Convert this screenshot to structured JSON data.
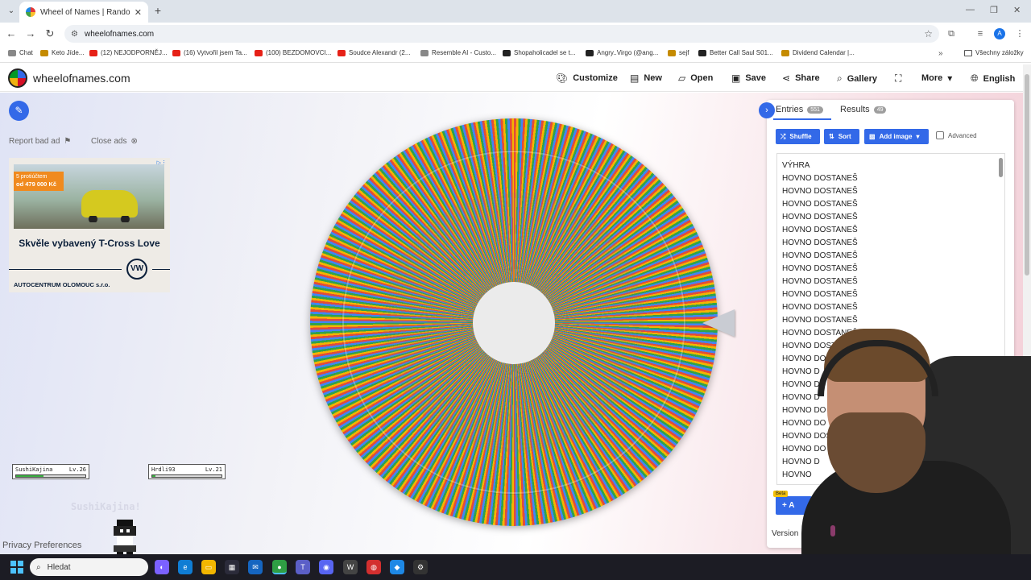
{
  "browser": {
    "tab_title": "Wheel of Names | Random nam",
    "url": "wheelofnames.com",
    "bookmarks": [
      "Chat",
      "Keto Jíde...",
      "(12) NEJODPORNĚJ...",
      "(16) Vytvořil jsem Ta...",
      "(100) BEZDOMOVCI...",
      "Soudce Alexandr (2...",
      "Resemble AI - Custo...",
      "Shopaholicadel se t...",
      "Angry..Virgo (@ang...",
      "sejf",
      "Better Call Saul S01...",
      "Dividend Calendar |..."
    ],
    "all_bookmarks": "Všechny záložky",
    "profile_initial": "A"
  },
  "site": {
    "name": "wheelofnames.com",
    "nav": {
      "customize": "Customize",
      "new": "New",
      "open": "Open",
      "save": "Save",
      "share": "Share",
      "gallery": "Gallery",
      "more": "More",
      "language": "English"
    }
  },
  "left": {
    "report_ad": "Report bad ad",
    "close_ads": "Close ads",
    "ad": {
      "promo_small": "5 protiúčtem",
      "promo_price": "od 479 000 Kč",
      "headline": "Skvěle vybavený T-Cross Love",
      "logo_text": "VW",
      "dealer": "AUTOCENTRUM OLOMOUC s.r.o."
    },
    "players": [
      {
        "name": "SushiKajina",
        "level": "Lv.26",
        "hp": 0.4
      },
      {
        "name": "Hrdli93",
        "level": "Lv.21",
        "hp": 0.05
      }
    ],
    "ghost_name": "SushiKajina!",
    "privacy": "Privacy Preferences"
  },
  "panel": {
    "tabs": {
      "entries_label": "Entries",
      "entries_count": "551",
      "results_label": "Results",
      "results_count": "49"
    },
    "buttons": {
      "shuffle": "Shuffle",
      "sort": "Sort",
      "add_image": "Add image",
      "advanced": "Advanced"
    },
    "entries": [
      "VÝHRA",
      "HOVNO DOSTANEŠ",
      "HOVNO DOSTANEŠ",
      "HOVNO DOSTANEŠ",
      "HOVNO DOSTANEŠ",
      "HOVNO DOSTANEŠ",
      "HOVNO DOSTANEŠ",
      "HOVNO DOSTANEŠ",
      "HOVNO DOSTANEŠ",
      "HOVNO DOSTANEŠ",
      "HOVNO DOSTANEŠ",
      "HOVNO DOSTANEŠ",
      "HOVNO DOSTANEŠ",
      "HOVNO DOSTANEŠ",
      "HOVNO DOST",
      "HOVNO DO",
      "HOVNO D",
      "HOVNO D",
      "HOVNO D",
      "HOVNO DO",
      "HOVNO DO",
      "HOVNO DOS",
      "HOVNO DO",
      "HOVNO D",
      "HOVNO"
    ],
    "beta": "Beta",
    "add_label": "A",
    "version": "Version"
  },
  "taskbar": {
    "search_placeholder": "Hledat"
  },
  "colors": {
    "accent": "#3369e8",
    "wheel_red": "#e34b3a",
    "wheel_yellow": "#f4b400",
    "wheel_green": "#2fa34a",
    "wheel_blue": "#4285f4"
  }
}
